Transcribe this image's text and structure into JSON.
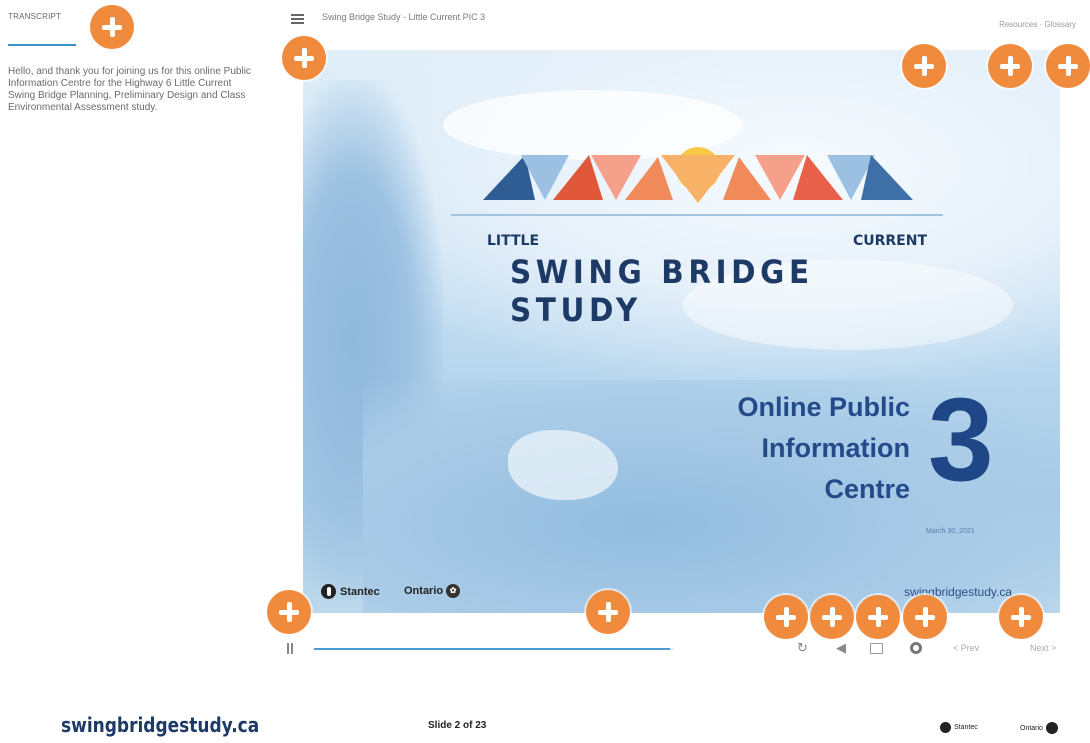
{
  "sidebar": {
    "tab_label": "TRANSCRIPT",
    "transcript_text": "Hello, and thank you for joining us for this online Public Information Centre for the Highway 6 Little Current Swing Bridge Planning, Preliminary Design and Class Environmental Assessment study."
  },
  "topbar": {
    "title": "Swing Bridge Study - Little Current PIC 3",
    "links": "Resources  ·  Glossary"
  },
  "slide": {
    "title_small": "LITTLE CURRENT",
    "title_big": "SWING BRIDGE STUDY",
    "pic_line1": "Online Public",
    "pic_line2": "Information",
    "pic_line3": "Centre",
    "pic_number": "3",
    "date": "March 30, 2021",
    "logo_stantec": "Stantec",
    "logo_ontario": "Ontario",
    "url": "swingbridgestudy.ca",
    "logo_colors": [
      "#2f5d93",
      "#e0573a",
      "#f08a5b",
      "#f7c948",
      "#e8604a",
      "#3e6fa7"
    ]
  },
  "player": {
    "progress_fraction": 0.99,
    "prev_label": "< Prev",
    "next_label": "Next >"
  },
  "footer": {
    "site": "swingbridgestudy.ca",
    "slide_counter": "Slide 2 of 23",
    "stantec": "Stantec",
    "ontario": "Ontario"
  },
  "accent_colors": {
    "hotspot": "#f08a3c",
    "brand_navy": "#1d3a66",
    "progress": "#4a9bd4"
  }
}
